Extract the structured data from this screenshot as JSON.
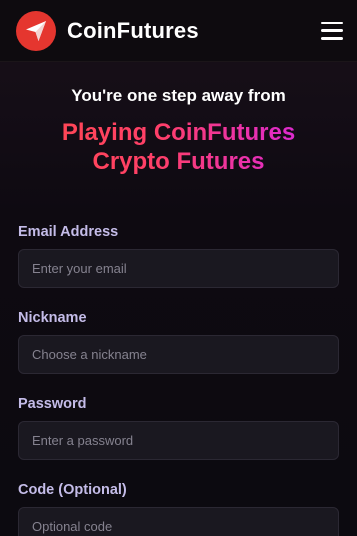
{
  "header": {
    "brand": "CoinFutures",
    "logo_icon": "paper-plane-icon",
    "menu_icon": "hamburger-menu-icon",
    "accent_color": "#e5362f"
  },
  "hero": {
    "subtitle": "You're one step away from",
    "title_line1": "Playing CoinFutures",
    "title_line2": "Crypto Futures",
    "gradient_colors": [
      "#ff4a4a",
      "#c431e6"
    ]
  },
  "form": {
    "email": {
      "label": "Email Address",
      "placeholder": "Enter your email"
    },
    "nickname": {
      "label": "Nickname",
      "placeholder": "Choose a nickname"
    },
    "password": {
      "label": "Password",
      "placeholder": "Enter a password"
    },
    "code": {
      "label": "Code (Optional)",
      "placeholder": "Optional code"
    }
  }
}
